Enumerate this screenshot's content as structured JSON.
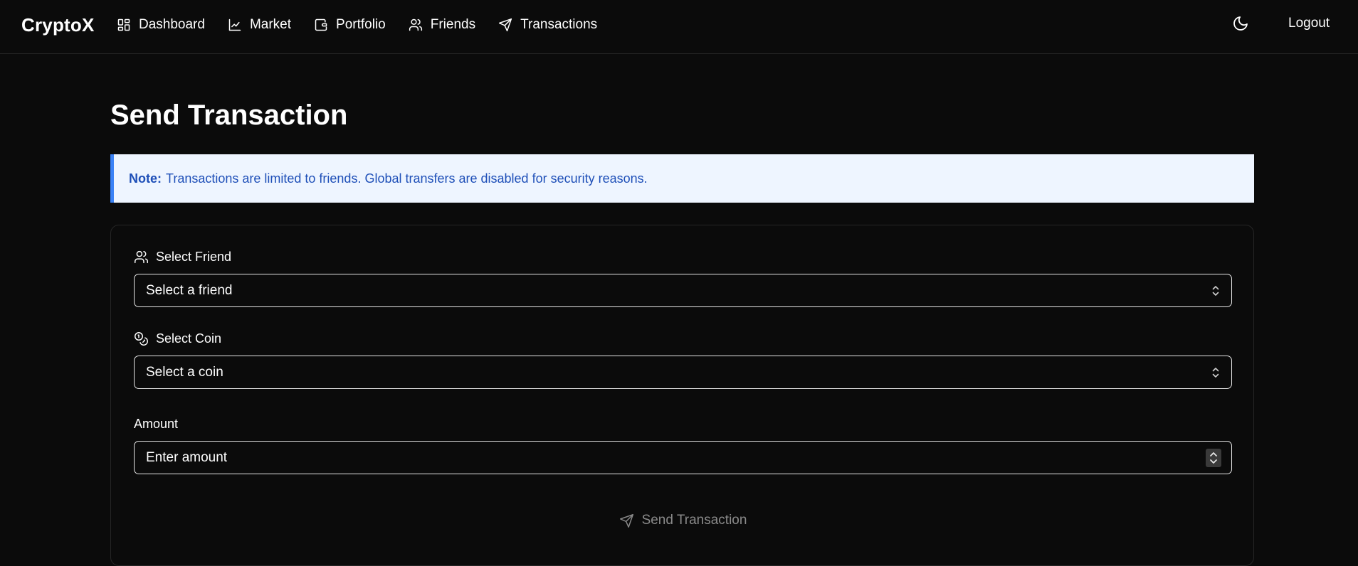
{
  "app": {
    "brand": "CryptoX",
    "logout_label": "Logout",
    "theme_toggle_icon": "moon-icon"
  },
  "nav": {
    "items": [
      {
        "label": "Dashboard",
        "icon": "layout-grid-icon"
      },
      {
        "label": "Market",
        "icon": "line-chart-icon"
      },
      {
        "label": "Portfolio",
        "icon": "wallet-icon"
      },
      {
        "label": "Friends",
        "icon": "users-icon"
      },
      {
        "label": "Transactions",
        "icon": "send-icon"
      }
    ]
  },
  "page": {
    "title": "Send Transaction",
    "note_label": "Note:",
    "note_text": "Transactions are limited to friends. Global transfers are disabled for security reasons."
  },
  "form": {
    "friend": {
      "label": "Select Friend",
      "icon": "users-icon",
      "value": "Select a friend"
    },
    "coin": {
      "label": "Select Coin",
      "icon": "coins-icon",
      "value": "Select a coin"
    },
    "amount": {
      "label": "Amount",
      "placeholder": "Enter amount"
    },
    "submit_label": "Send Transaction",
    "submit_icon": "send-icon"
  },
  "colors": {
    "background": "#0b0b0b",
    "note_background": "#eef5ff",
    "note_accent": "#3b82f6",
    "note_text": "#1e4fb8",
    "disabled_text": "#8a8a8a"
  }
}
